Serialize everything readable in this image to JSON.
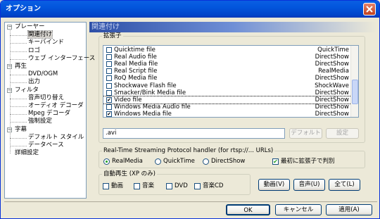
{
  "window": {
    "title": "オプション"
  },
  "tree": [
    {
      "label": "プレーヤー",
      "level": 0,
      "expander": "−"
    },
    {
      "label": "関連付け",
      "level": 1,
      "selected": true
    },
    {
      "label": "キーバインド",
      "level": 1
    },
    {
      "label": "ロゴ",
      "level": 1
    },
    {
      "label": "ウェブ インターフェース",
      "level": 1
    },
    {
      "label": "再生",
      "level": 0,
      "expander": "−"
    },
    {
      "label": "DVD/OGM",
      "level": 1
    },
    {
      "label": "出力",
      "level": 1
    },
    {
      "label": "フィルタ",
      "level": 0,
      "expander": "−"
    },
    {
      "label": "音声切り替え",
      "level": 1
    },
    {
      "label": "オーディオ デコーダ",
      "level": 1
    },
    {
      "label": "Mpeg デコーダ",
      "level": 1
    },
    {
      "label": "強制設定",
      "level": 1
    },
    {
      "label": "字幕",
      "level": 0,
      "expander": "−"
    },
    {
      "label": "デフォルト スタイル",
      "level": 1
    },
    {
      "label": "データベース",
      "level": 1
    },
    {
      "label": "詳細設定",
      "level": 0
    }
  ],
  "panel": {
    "header": "関連付け"
  },
  "extensions": {
    "group_label": "拡張子",
    "rows": [
      {
        "name": "Quicktime file",
        "value": "QuickTime",
        "checked": false
      },
      {
        "name": "Real Audio file",
        "value": "DirectShow",
        "checked": false
      },
      {
        "name": "Real Media file",
        "value": "DirectShow",
        "checked": false
      },
      {
        "name": "Real Script file",
        "value": "RealMedia",
        "checked": false
      },
      {
        "name": "RoQ Media file",
        "value": "DirectShow",
        "checked": false
      },
      {
        "name": "Shockwave Flash file",
        "value": "ShockWave",
        "checked": false
      },
      {
        "name": "Smacker/Bink Media file",
        "value": "DirectShow",
        "checked": false
      },
      {
        "name": "Video file",
        "value": "DirectShow",
        "checked": true,
        "focused": true
      },
      {
        "name": "Windows Media Audio file",
        "value": "DirectShow",
        "checked": false
      },
      {
        "name": "Windows Media file",
        "value": "DirectShow",
        "checked": true
      }
    ],
    "ext_value": ".avi",
    "default_btn": "デフォルト",
    "settings_btn": "設定"
  },
  "rtsp": {
    "group_label": "Real-Time Streaming Protocol handler (for rtsp://... URLs)",
    "options": [
      "RealMedia",
      "QuickTime",
      "DirectShow"
    ],
    "selected": "RealMedia",
    "check_label": "最初に拡張子で判別",
    "check_checked": true
  },
  "autoplay": {
    "group_label": "自動再生 (XP のみ)",
    "items": [
      "動画",
      "音楽",
      "DVD",
      "音楽CD"
    ]
  },
  "quick_buttons": [
    "動画(V)",
    "音声(U)",
    "全て(L)"
  ],
  "footer": {
    "ok": "OK",
    "cancel": "キャンセル",
    "apply": "適用(A)"
  }
}
